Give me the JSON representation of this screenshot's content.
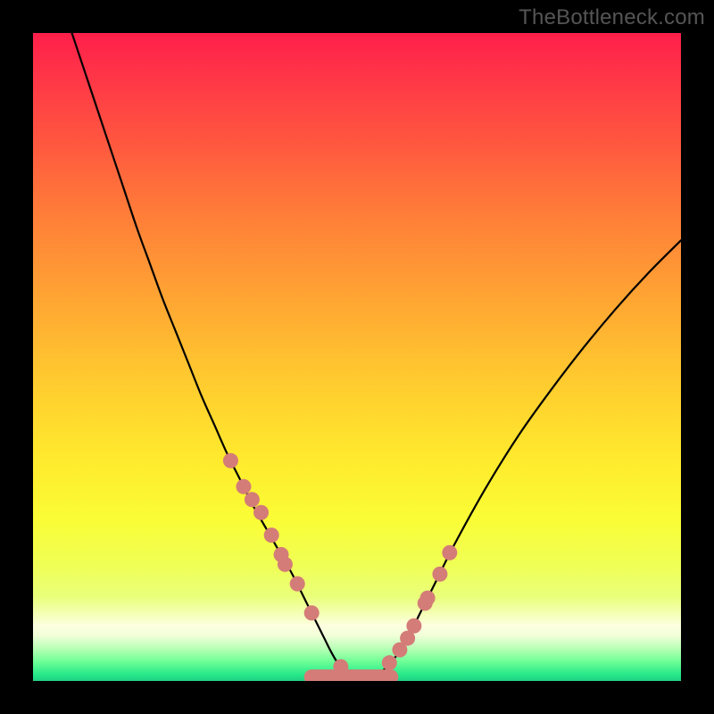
{
  "watermark": "TheBottleneck.com",
  "colors": {
    "curve": "#000000",
    "marker_fill": "#d47c78",
    "marker_stroke": "#c96f6b",
    "background_black": "#000000"
  },
  "chart_data": {
    "type": "line",
    "title": "",
    "xlabel": "",
    "ylabel": "",
    "xlim": [
      0,
      100
    ],
    "ylim": [
      0,
      100
    ],
    "grid": false,
    "legend": false,
    "series": [
      {
        "name": "bottleneck-curve",
        "x": [
          6,
          8,
          10,
          12,
          14,
          16,
          18,
          20,
          22,
          24,
          26,
          28,
          30,
          32,
          34,
          36,
          38,
          40,
          42,
          43,
          44,
          45,
          46,
          47,
          48,
          49,
          50,
          52,
          54,
          56,
          58,
          60,
          62,
          65,
          70,
          75,
          80,
          85,
          90,
          95,
          100
        ],
        "y": [
          100,
          94,
          88,
          82,
          76,
          70,
          64.5,
          59,
          54,
          49,
          44,
          39.5,
          35,
          31,
          27,
          23.5,
          20,
          16.5,
          12.5,
          10.5,
          8.5,
          6.5,
          4.5,
          2.8,
          1.6,
          0.8,
          0.4,
          0.6,
          1.6,
          3.8,
          7.0,
          11.0,
          15.0,
          21.0,
          30.0,
          38.0,
          45.0,
          51.5,
          57.5,
          63.0,
          68.0
        ]
      }
    ],
    "markers": {
      "name": "emphasis-points",
      "x": [
        30.5,
        32.5,
        33.8,
        35.2,
        36.8,
        38.3,
        38.9,
        40.8,
        43.0,
        47.5,
        49.5,
        51.0,
        55.0,
        56.6,
        57.8,
        58.8,
        60.5,
        60.9,
        62.8,
        64.3
      ],
      "y": [
        34.0,
        30.0,
        28.0,
        26.0,
        22.5,
        19.5,
        18.0,
        15.0,
        10.5,
        2.2,
        0.5,
        0.5,
        2.8,
        4.8,
        6.6,
        8.5,
        12.0,
        12.8,
        16.5,
        19.8
      ]
    },
    "bottom_band": {
      "x": [
        43.0,
        55.2
      ],
      "y": 0.6
    }
  }
}
